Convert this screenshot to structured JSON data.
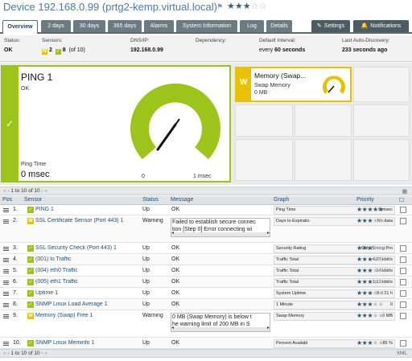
{
  "header": {
    "device_label": "Device",
    "device_name": "192.168.0.99 (prtg2-kemp.virtual.local)",
    "flag_icon": "flag-icon",
    "priority_stars_on": "★★★",
    "priority_stars_off": "☆☆",
    "priority": 3
  },
  "tabs": [
    {
      "label": "Overview"
    },
    {
      "label": "2 days"
    },
    {
      "label": "30 days"
    },
    {
      "label": "365 days"
    },
    {
      "label": "Alarms"
    },
    {
      "label": "System Information"
    },
    {
      "label": "Log"
    },
    {
      "label": "Details"
    },
    {
      "label": "Settings",
      "icon": "wrench-icon"
    },
    {
      "label": "Notifications",
      "icon": "bell-icon"
    }
  ],
  "info": {
    "status_label": "Status:",
    "status_value": "OK",
    "sensors_label": "Sensors:",
    "sensors_warning": "2",
    "sensors_ok": "8",
    "sensors_total": "(of 10)",
    "dns_label": "DNS/IP:",
    "dns_value": "192.168.0.99",
    "dependency_label": "Dependency:",
    "dependency_value": "",
    "interval_label": "Default Interval:",
    "interval_prefix": "every",
    "interval_num": "60",
    "interval_unit": "seconds",
    "discovery_label": "Last Auto-Discovery:",
    "discovery_num": "233",
    "discovery_unit": "seconds ago"
  },
  "gauges": {
    "main": {
      "title": "PING 1",
      "status": "OK",
      "channel": "Ping Time",
      "value": "0 msec",
      "min_label": "0",
      "max_label": "1 msec",
      "color": "#9cc41b"
    },
    "memory": {
      "title": "Memory (Swap...",
      "channel": "Swap Memory",
      "value": "0 MB",
      "badge": "W",
      "color": "#e8c200"
    }
  },
  "pager": {
    "first": "«",
    "prev": "‹",
    "range": "1 to 10 of 10",
    "next": "›",
    "last": "»"
  },
  "table": {
    "columns": [
      "Pos",
      "Sensor",
      "Status",
      "Message",
      "Graph",
      "Priority"
    ],
    "rows": [
      {
        "pos": "1.",
        "status_badge": "✓",
        "sensor": "PING 1",
        "status": "Up",
        "message": "OK",
        "graph_label": "Ping Time",
        "graph_value": "0 msec",
        "priority": 5
      },
      {
        "pos": "2.",
        "status_badge": "W",
        "sensor": "SSL Certificate Sensor (Port 443) 1",
        "status": "Warning",
        "message": "Failed to establish secure connec\ntion [Step 0] Error connecting wi",
        "graph_label": "Days to Expiratio",
        "graph_value": "No data",
        "priority": 3
      },
      {
        "pos": "3.",
        "status_badge": "✓",
        "sensor": "SSL Security Check (Port 443) 1",
        "status": "Up",
        "message": "OK",
        "graph_label": "Security Rating",
        "graph_value": "Only Strong Pro",
        "priority": 3
      },
      {
        "pos": "4.",
        "status_badge": "✓",
        "sensor": "(001) lo Traffic",
        "status": "Up",
        "message": "OK",
        "graph_label": "Traffic Total",
        "graph_value": "4,07 kbit/s",
        "priority": 3
      },
      {
        "pos": "5.",
        "status_badge": "✓",
        "sensor": "(004) eth0 Traffic",
        "status": "Up",
        "message": "OK",
        "graph_label": "Traffic Total",
        "graph_value": "14 kbit/s",
        "priority": 3
      },
      {
        "pos": "6.",
        "status_badge": "✓",
        "sensor": "(005) eth1 Traffic",
        "status": "Up",
        "message": "OK",
        "graph_label": "Traffic Total",
        "graph_value": "1,13 kbit/s",
        "priority": 3
      },
      {
        "pos": "7.",
        "status_badge": "✓",
        "sensor": "Uptime 1",
        "status": "Up",
        "message": "OK",
        "graph_label": "System Uptime",
        "graph_value": "8 d 21 h",
        "priority": 3
      },
      {
        "pos": "8.",
        "status_badge": "✓",
        "sensor": "SNMP Linux Load Average 1",
        "status": "Up",
        "message": "OK",
        "graph_label": "1 Minute",
        "graph_value": "0",
        "priority": 3
      },
      {
        "pos": "9.",
        "status_badge": "W",
        "sensor": "Memory (Swap) Free 1",
        "status": "Warning",
        "message": "0 MB (Swap Memory) is below t\nhe warning limit of 200 MB in S",
        "graph_label": "Swap Memory",
        "graph_value": "0 MB",
        "priority": 3
      },
      {
        "pos": "10.",
        "status_badge": "✓",
        "sensor": "SNMP Linux Meminfo 1",
        "status": "Up",
        "message": "OK",
        "graph_label": "Percent Availabl",
        "graph_value": "85 %",
        "priority": 3
      }
    ]
  },
  "footer": {
    "xml_label": "XML"
  }
}
